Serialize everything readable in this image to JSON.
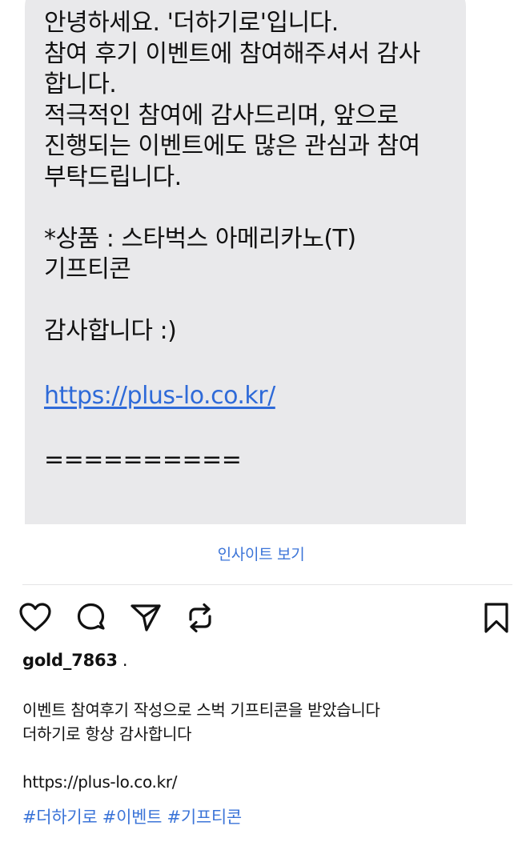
{
  "message": {
    "lines": [
      "안녕하세요. '더하기로'입니다.",
      "참여 후기 이벤트에 참여해주셔서 감사",
      "합니다.",
      "적극적인 참여에 감사드리며, 앞으로",
      "진행되는 이벤트에도 많은 관심과 참여",
      "부탁드립니다.",
      "",
      "*상품 : 스타벅스 아메리카노(T)",
      "기프티콘",
      "",
      "감사합니다 :)",
      ""
    ],
    "link": "https://plus-lo.co.kr/",
    "separator": "=========="
  },
  "insight_label": "인사이트 보기",
  "actions": {
    "like_icon": "heart-icon",
    "comment_icon": "comment-icon",
    "share_icon": "send-icon",
    "repost_icon": "repost-icon",
    "save_icon": "bookmark-icon"
  },
  "post": {
    "username": "gold_7863",
    "username_suffix": ".",
    "caption_lines": [
      "이벤트 참여후기 작성으로 스벅 기프티콘을 받았습니다",
      "더하기로 항상 감사합니다"
    ],
    "caption_url": "https://plus-lo.co.kr/",
    "hashtags": [
      "#더하기로",
      "#이벤트",
      "#기프티콘"
    ]
  },
  "colors": {
    "bubble_bg": "#e9e9eb",
    "link": "#2e6ad8",
    "accent": "#3b74d8"
  }
}
